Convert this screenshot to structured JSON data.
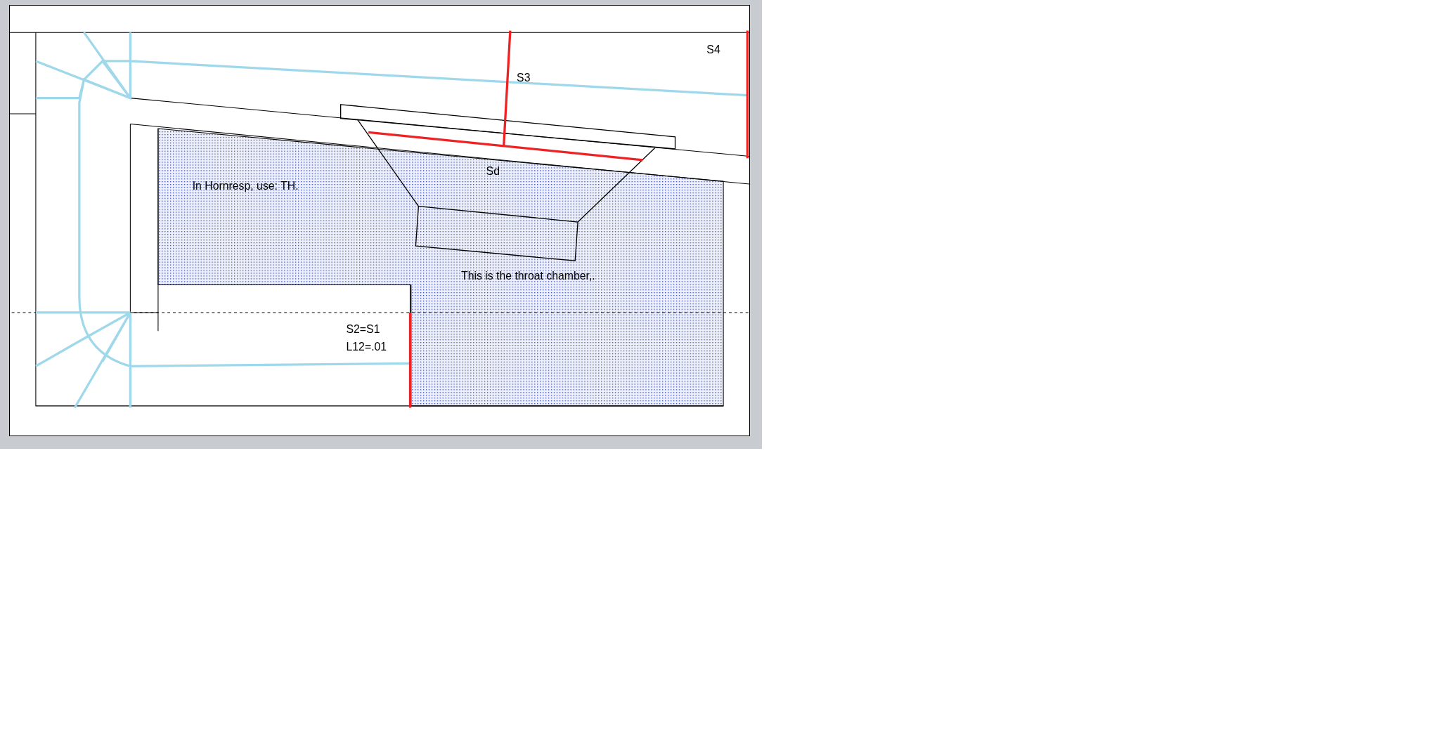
{
  "canvas": {
    "labels": [
      {
        "text": "S4"
      },
      {
        "text": "S3"
      },
      {
        "text": "Sd"
      },
      {
        "text": "In Hornresp, use: TH."
      },
      {
        "text": "This is the throat chamber,."
      },
      {
        "text": "S2=S1"
      },
      {
        "text": "L12=.01"
      }
    ]
  }
}
